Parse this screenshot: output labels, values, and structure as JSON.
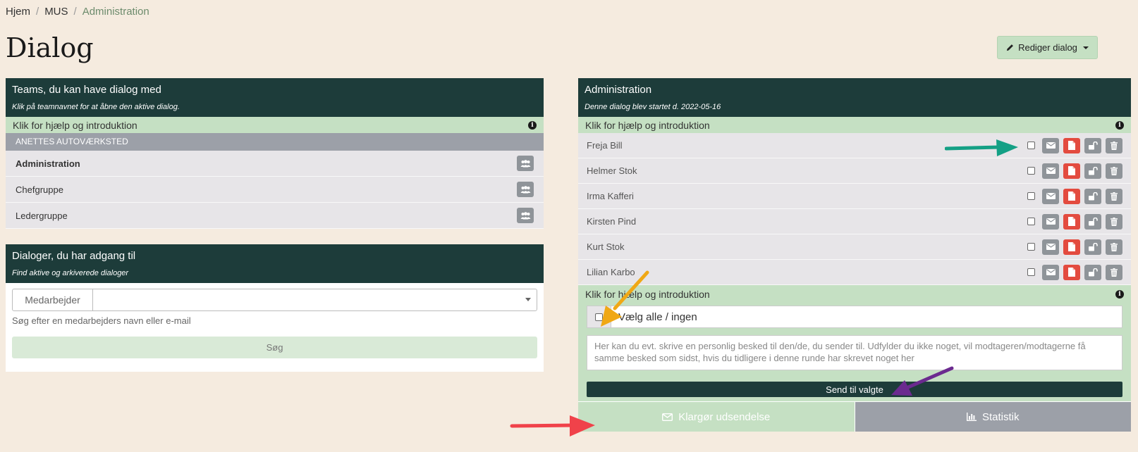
{
  "breadcrumb": {
    "home": "Hjem",
    "mus": "MUS",
    "current": "Administration"
  },
  "page": {
    "title": "Dialog",
    "edit_label": "Rediger dialog"
  },
  "teams_panel": {
    "title": "Teams, du kan have dialog med",
    "subtitle": "Klik på teamnavnet for at åbne den aktive dialog.",
    "help": "Klik for hjælp og introduktion",
    "group": "ANETTES AUTOVÆRKSTED",
    "teams": [
      {
        "name": "Administration"
      },
      {
        "name": "Chefgruppe"
      },
      {
        "name": "Ledergruppe"
      }
    ]
  },
  "dialogs_panel": {
    "title": "Dialoger, du har adgang til",
    "subtitle": "Find aktive og arkiverede dialoger",
    "addon": "Medarbejder",
    "help_text": "Søg efter en medarbejders navn eller e-mail",
    "search_label": "Søg"
  },
  "admin_panel": {
    "title": "Administration",
    "subtitle": "Denne dialog blev startet d. 2022-05-16",
    "help": "Klik for hjælp og introduktion",
    "help2": "Klik for hjælp og introduktion",
    "members": [
      {
        "name": "Freja Bill"
      },
      {
        "name": "Helmer Stok"
      },
      {
        "name": "Irma Kafferi"
      },
      {
        "name": "Kirsten Pind"
      },
      {
        "name": "Kurt Stok"
      },
      {
        "name": "Lilian Karbo"
      }
    ],
    "select_all": "Vælg alle / ingen",
    "message_placeholder": "Her kan du evt. skrive en personlig besked til den/de, du sender til. Udfylder du ikke noget, vil modtageren/modtagerne få samme besked som sidst, hvis du tidligere i denne runde har skrevet noget her",
    "send_label": "Send til valgte",
    "prepare_label": "Klargør udsendelse",
    "stats_label": "Statistik"
  },
  "colors": {
    "dark_green": "#1d3c3a",
    "light_green": "#c5e0c3",
    "grey": "#9ca0a8",
    "red": "#e34b3f",
    "bg": "#f5ebdf"
  }
}
